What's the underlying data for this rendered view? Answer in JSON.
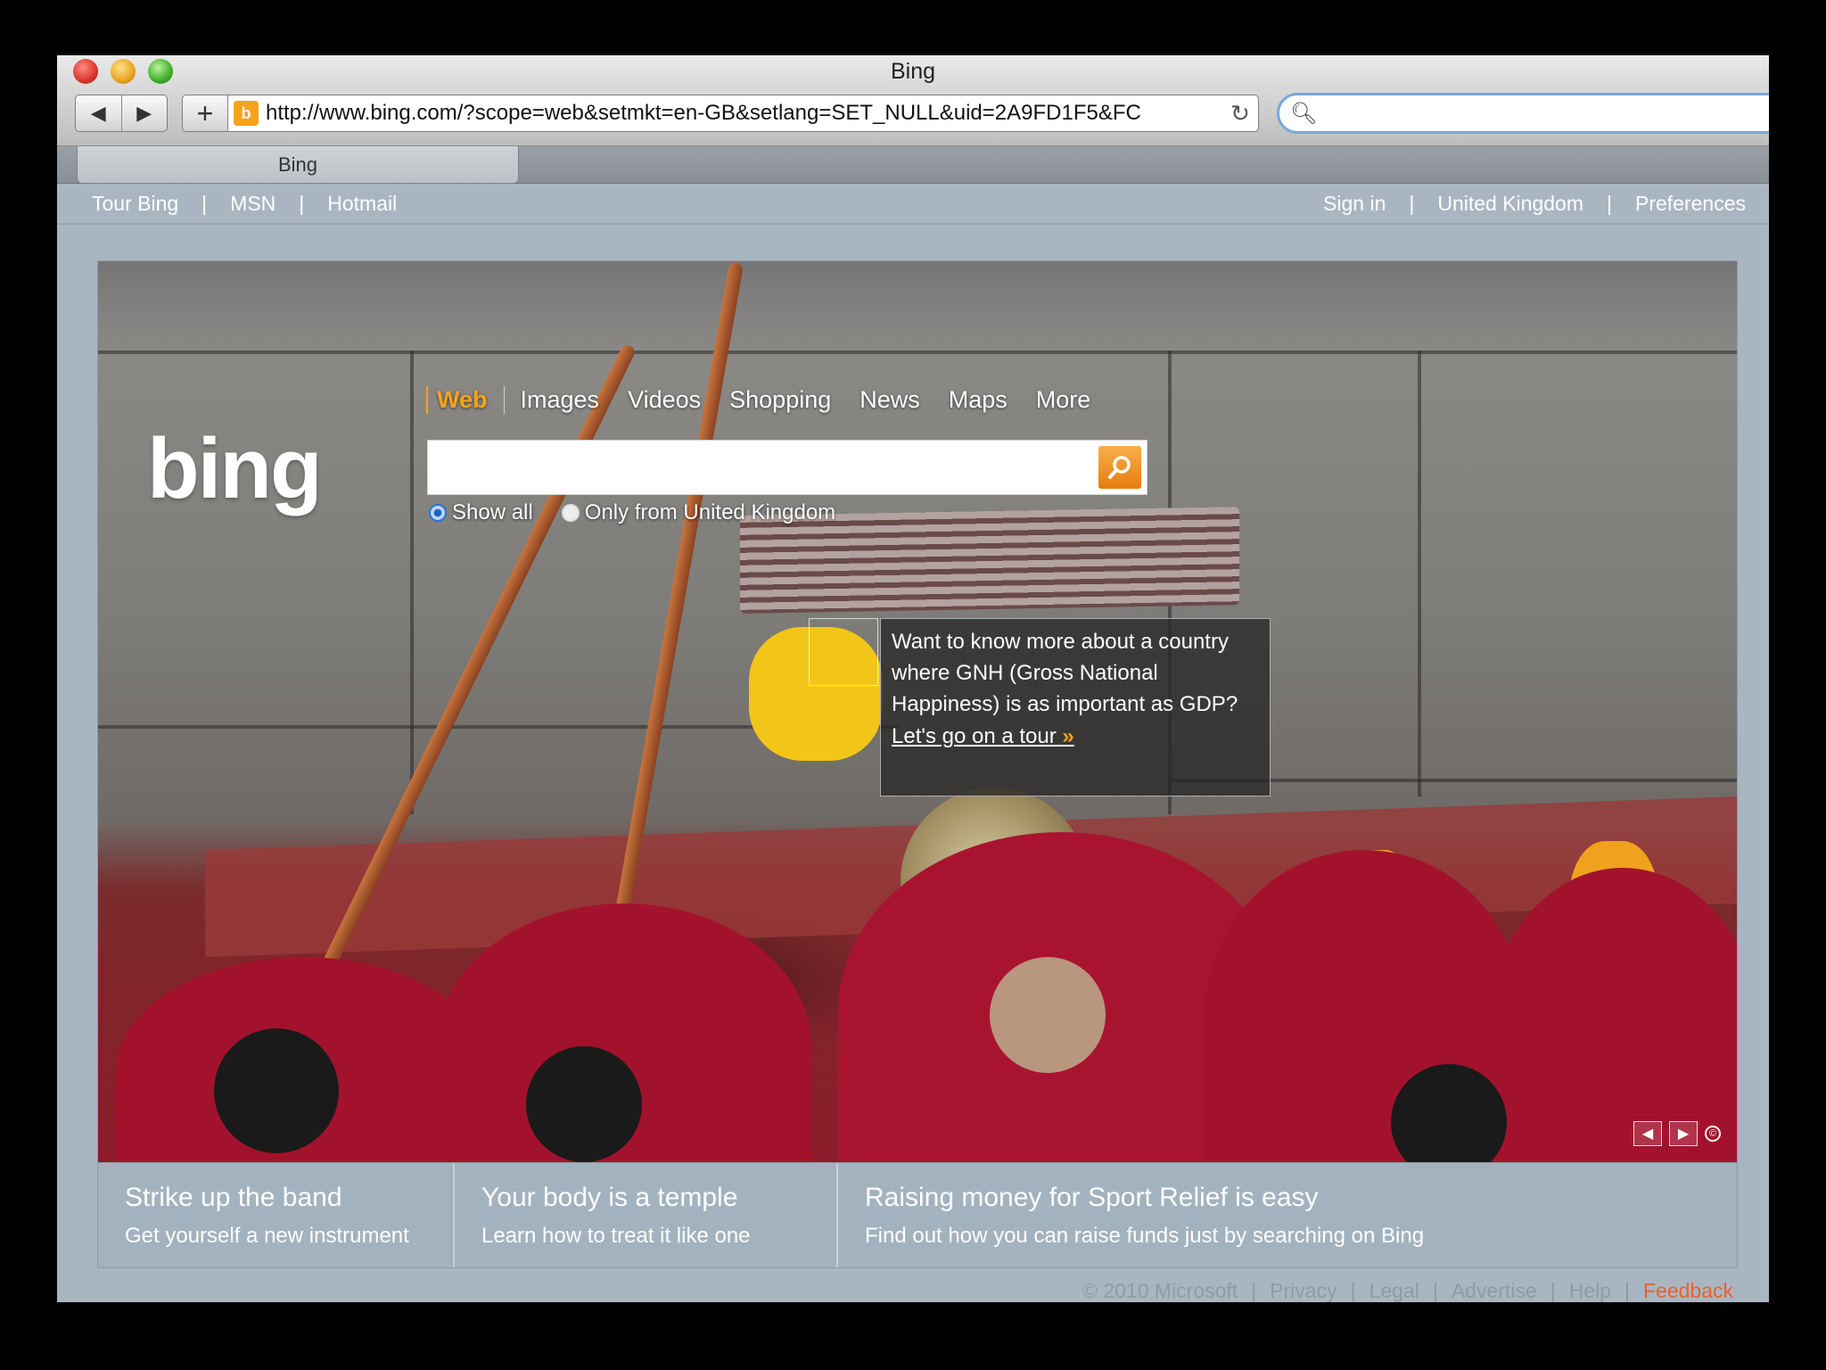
{
  "browser": {
    "title": "Bing",
    "url": "http://www.bing.com/?scope=web&setmkt=en-GB&setlang=SET_NULL&uid=2A9FD1F5&FC",
    "tab_label": "Bing",
    "search_placeholder": ""
  },
  "topbar": {
    "left": [
      "Tour Bing",
      "MSN",
      "Hotmail"
    ],
    "right": [
      "Sign in",
      "United Kingdom",
      "Preferences"
    ]
  },
  "logo": "bing",
  "scopes": {
    "active": "Web",
    "items": [
      "Images",
      "Videos",
      "Shopping",
      "News",
      "Maps",
      "More"
    ]
  },
  "search": {
    "value": "",
    "filter_all": "Show all",
    "filter_local": "Only from United Kingdom"
  },
  "callout": {
    "text": "Want to know more about a country where GNH (Gross National Happiness) is as important as GDP?",
    "link": "Let's go on a tour"
  },
  "promos": [
    {
      "title": "Strike up the band",
      "subtitle": "Get yourself a new instrument"
    },
    {
      "title": "Your body is a temple",
      "subtitle": "Learn how to treat it like one"
    },
    {
      "title": "Raising money for Sport Relief is easy",
      "subtitle": "Find out how you can raise funds just by searching on Bing"
    }
  ],
  "footer": {
    "copyright": "© 2010 Microsoft",
    "links": [
      "Privacy",
      "Legal",
      "Advertise",
      "Help"
    ],
    "feedback": "Feedback"
  },
  "colors": {
    "accent": "#f6a31c",
    "feedback": "#e8622b",
    "page_bg": "#a9b6c2"
  }
}
